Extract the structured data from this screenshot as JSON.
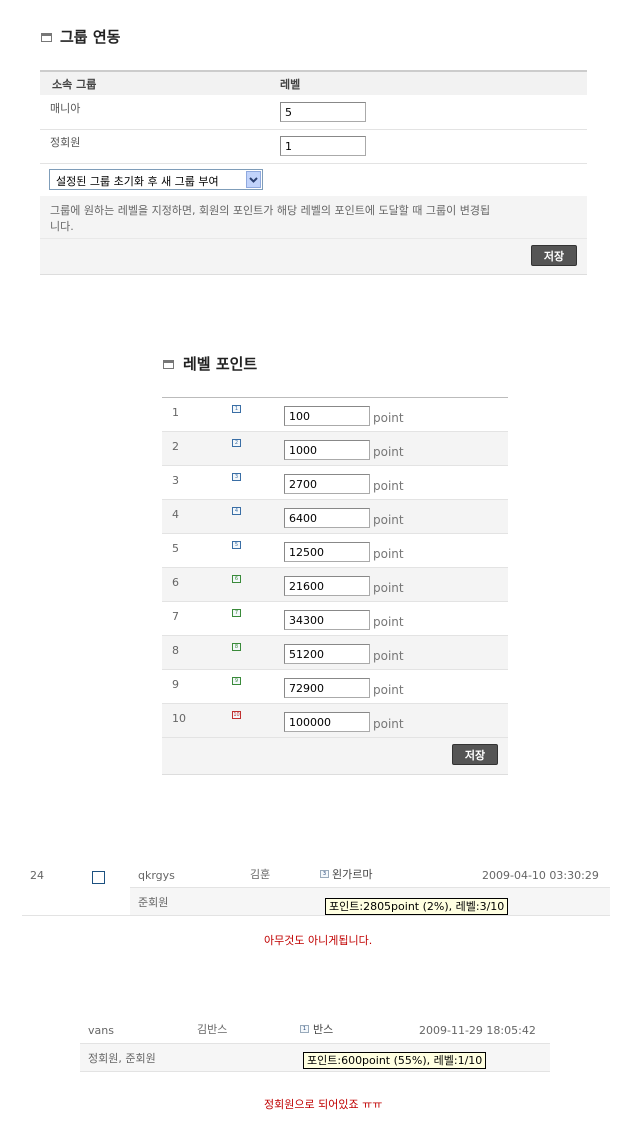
{
  "group_section": {
    "title": "그룹 연동",
    "col_group": "소속 그룹",
    "col_level": "레벨",
    "rows": [
      {
        "name": "매니아",
        "level": "5"
      },
      {
        "name": "정회원",
        "level": "1"
      }
    ],
    "select_value": "설정된 그룹 초기화 후 새 그룹 부여",
    "help_line1": "그룹에 원하는 레벨을 지정하면, 회원의 포인트가 해당 레벨의 포인트에 도달할 때 그룹이 변경됩",
    "help_line2": "니다.",
    "save_label": "저장"
  },
  "level_section": {
    "title": "레벨 포인트",
    "unit": "point",
    "rows": [
      {
        "level": "1",
        "icon": "1",
        "point": "100"
      },
      {
        "level": "2",
        "icon": "2",
        "point": "1000"
      },
      {
        "level": "3",
        "icon": "3",
        "point": "2700"
      },
      {
        "level": "4",
        "icon": "4",
        "point": "6400"
      },
      {
        "level": "5",
        "icon": "5",
        "point": "12500"
      },
      {
        "level": "6",
        "icon": "6",
        "point": "21600"
      },
      {
        "level": "7",
        "icon": "7",
        "point": "34300"
      },
      {
        "level": "8",
        "icon": "8",
        "point": "51200"
      },
      {
        "level": "9",
        "icon": "9",
        "point": "72900"
      },
      {
        "level": "10",
        "icon": "10",
        "point": "100000"
      }
    ],
    "save_label": "저장"
  },
  "member1": {
    "no": "24",
    "id": "qkrgys",
    "name": "김훈",
    "level_icon": "3",
    "nick": "왼가르마",
    "date": "2009-04-10 03:30:29",
    "groups": "준회원",
    "tooltip": "포인트:2805point (2%), 레벨:3/10",
    "comment": "아무것도 아니게됩니다."
  },
  "member2": {
    "id": "vans",
    "name": "김반스",
    "level_icon": "1",
    "nick": "반스",
    "date": "2009-11-29 18:05:42",
    "groups": "정회원, 준회원",
    "tooltip": "포인트:600point (55%), 레벨:1/10",
    "comment": "정회원으로 되어있죠 ㅠㅠ"
  },
  "colors": {
    "accent_red": "#c00000",
    "save_button": "#555555",
    "tooltip_bg": "#ffffe1"
  }
}
